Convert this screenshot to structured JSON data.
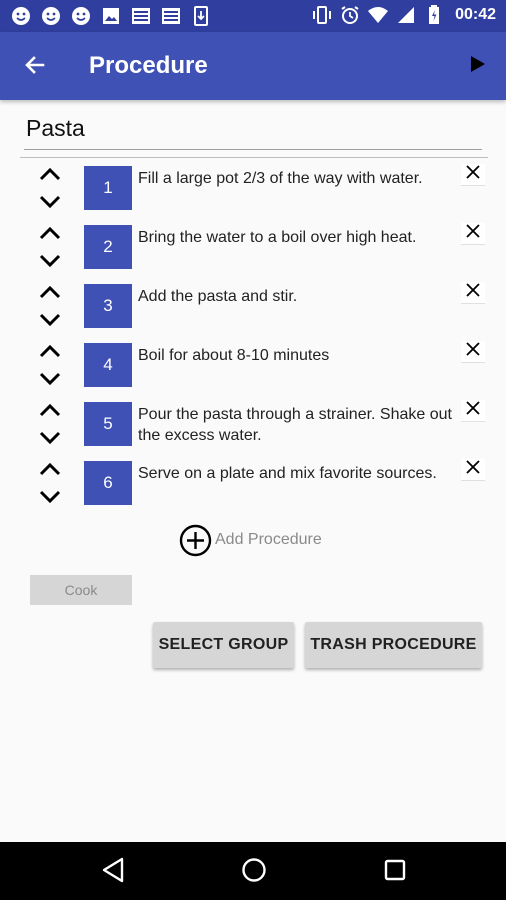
{
  "status_bar": {
    "time": "00:42",
    "left_icons": [
      "smiley-icon",
      "smiley-icon",
      "smiley-icon",
      "image-icon",
      "newspaper-icon",
      "newspaper-icon",
      "download-icon"
    ],
    "right_icons": [
      "vibrate-icon",
      "alarm-icon",
      "wifi-icon",
      "signal-icon",
      "battery-icon"
    ]
  },
  "app_bar": {
    "title": "Procedure",
    "back_icon": "arrow-left-icon",
    "play_icon": "play-icon"
  },
  "procedure_name": "Pasta",
  "steps": [
    {
      "number": "1",
      "text": "Fill a large pot 2/3 of the way with water."
    },
    {
      "number": "2",
      "text": "Bring the water to a boil over high heat."
    },
    {
      "number": "3",
      "text": "Add the pasta and stir."
    },
    {
      "number": "4",
      "text": "Boil for about 8-10 minutes"
    },
    {
      "number": "5",
      "text": "Pour the pasta through a strainer. Shake out the excess water."
    },
    {
      "number": "6",
      "text": "Serve on a plate and mix favorite sources."
    }
  ],
  "add_procedure_label": "Add Procedure",
  "cook_label": "Cook",
  "buttons": {
    "select_group": "SELECT GROUP",
    "trash_procedure": "TRASH PROCEDURE"
  },
  "colors": {
    "primary": "#3f51b5",
    "primary_dark": "#303f9f",
    "button_gray": "#d6d6d6",
    "background": "#fafafa"
  }
}
